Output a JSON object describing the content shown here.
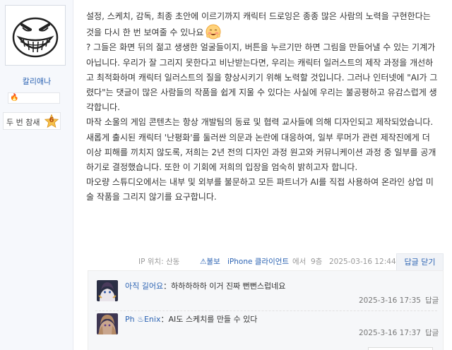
{
  "author": {
    "username": "칼리애나",
    "level_label": "두 번 참새",
    "level_number": "6"
  },
  "post": {
    "paragraphs": [
      "설정, 스케치, 감독, 최종 초안에 이르기까지 캐릭터 드로잉은 종종 많은 사람의 노력을 구현한다는 것을 다시 한 번 보여줄 수 있나요",
      "? 그들은 화면 뒤의 젊고 생생한 얼굴들이지, 버튼을 누르기만 하면 그림을 만들어낼 수 있는 기계가 아닙니다. 우리가 잘 그리지 못한다고 비난받는다면, 우리는 캐릭터 일러스트의 제작 과정을 개선하고 최적화하며 캐릭터 일러스트의 질을 향상시키기 위해 노력할 것입니다. 그러나 인터넷에 \"AI가 그렸다\"는 댓글이 많은 사람들의 작품을 쉽게 지울 수 있다는 사실에 우리는 불공평하고 유감스럽게 생각합니다.",
      "마작 소울의 게임 콘텐츠는 항상 개발팀의 동료 및 협력 교사들에 의해 디자인되고 제작되었습니다. 새롭게 출시된 캐릭터 '난평화'를 둘러싼 의문과 논란에 대응하여, 일부 루머가 관련 제작진에게 더 이상 피해를 끼치지 않도록, 저희는 2년 전의 디자인 과정 원고와 커뮤니케이션 과정 중 일부를 공개하기로 결정했습니다. 또한 이 기회에 저희의 입장을 엄숙히 밝히고자 합니다.",
      "마오량 스튜디오에서는 내부 및 외부를 불문하고 모든 파트너가 AI를 직접 사용하여 온라인 상업 미술 작품을 그리지 않기를 요구합니다."
    ]
  },
  "footer": {
    "ip_location": "IP 위치: 산동",
    "report_label": "⚠불보",
    "client": "iPhone 클라이언트",
    "from_label": "에서",
    "floor": "9층",
    "timestamp": "2025-03-16 12:44",
    "reply_toggle": "답글 닫기"
  },
  "replies": [
    {
      "name": "아직 길어요",
      "separator": "：",
      "text": "하하하하하 이거 진짜 뻔뻔스럽네요",
      "time": "2025-3-16 17:35",
      "reply_label": "답글"
    },
    {
      "name": "Ph ♨Enix",
      "separator": "：",
      "text": "AI도 스케치를 만들 수 있다",
      "time": "2025-3-16 17:37",
      "reply_label": "답글"
    }
  ],
  "colors": {
    "link": "#2d64b3",
    "meta": "#999999",
    "sidebar_bg": "#f6f8fc",
    "sub_area_bg": "#f6f7f9"
  },
  "icons": {
    "avatar": "grinning-doodle-face",
    "emoji": "blushing-smile-emoji",
    "badge": "fire-icon",
    "level": "star-badge-icon"
  }
}
